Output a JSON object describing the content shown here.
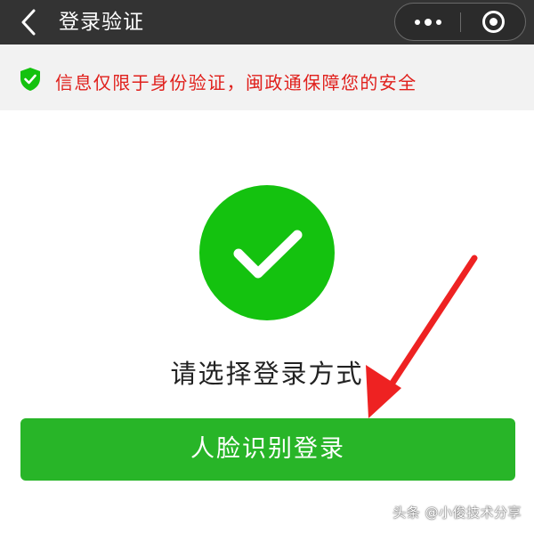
{
  "navbar": {
    "title": "登录验证",
    "back_icon": "chevron-left-icon",
    "more_icon": "more-dots-icon",
    "close_icon": "close-circle-icon",
    "background": "#333333"
  },
  "notice": {
    "icon": "shield-check-icon",
    "text": "信息仅限于身份验证，闽政通保障您的安全",
    "text_color": "#e0201c",
    "icon_color": "#14c20f"
  },
  "main": {
    "status_icon": "check-icon",
    "status_color": "#14c20f",
    "subtitle": "请选择登录方式",
    "primary_button_label": "人脸识别登录",
    "primary_button_color": "#28b528"
  },
  "annotation": {
    "icon": "red-arrow-icon",
    "color": "#ee2222"
  },
  "watermark": {
    "text": "头条 @小俊技术分享"
  }
}
